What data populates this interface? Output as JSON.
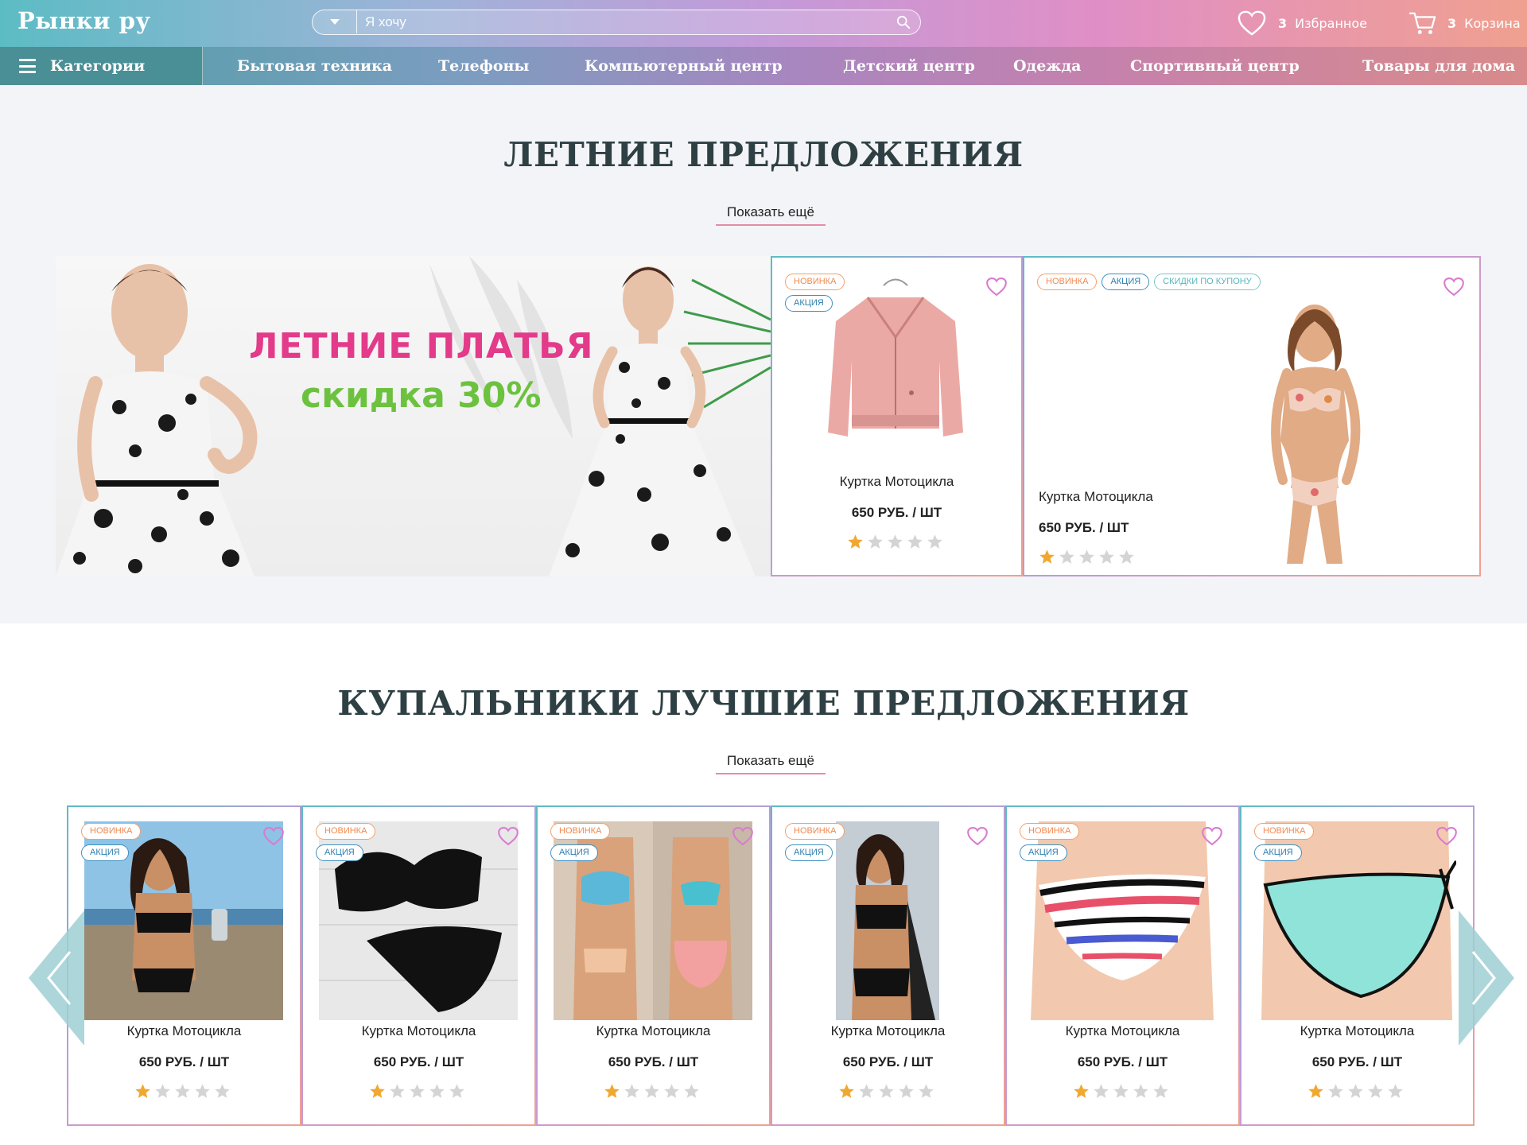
{
  "header": {
    "logo": "Рынки ру",
    "search_placeholder": "Я хочу",
    "favorites_count": "3",
    "favorites_label": "Избранное",
    "cart_count": "3",
    "cart_label": "Корзина"
  },
  "nav": {
    "categories_label": "Категории",
    "items": [
      "Бытовая техника",
      "Телефоны",
      "Компьютерный центр",
      "Детский центр",
      "Одежда",
      "Спортивный центр",
      "Товары для дома"
    ]
  },
  "summer": {
    "title": "ЛЕТНИЕ ПРЕДЛОЖЕНИЯ",
    "show_more": "Показать ещё",
    "banner": {
      "title": "ЛЕТНИЕ ПЛАТЬЯ",
      "subtitle": "скидка 30%"
    },
    "products": [
      {
        "badges": [
          "НОВИНКА",
          "АКЦИЯ"
        ],
        "name": "Куртка Мотоцикла",
        "price": "650 РУБ. / ШТ",
        "rating": 1,
        "max_rating": 5
      },
      {
        "badges": [
          "НОВИНКА",
          "АКЦИЯ",
          "СКИДКИ ПО КУПОНУ"
        ],
        "name": "Куртка Мотоцикла",
        "price": "650 РУБ. / ШТ",
        "rating": 1,
        "max_rating": 5
      }
    ]
  },
  "swimsuits": {
    "title": "КУПАЛЬНИКИ ЛУЧШИЕ ПРЕДЛОЖЕНИЯ",
    "show_more": "Показать ещё",
    "products": [
      {
        "badges": [
          "НОВИНКА",
          "АКЦИЯ"
        ],
        "name": "Куртка Мотоцикла",
        "price": "650 РУБ. / ШТ",
        "rating": 1,
        "max_rating": 5
      },
      {
        "badges": [
          "НОВИНКА",
          "АКЦИЯ"
        ],
        "name": "Куртка Мотоцикла",
        "price": "650 РУБ. / ШТ",
        "rating": 1,
        "max_rating": 5
      },
      {
        "badges": [
          "НОВИНКА",
          "АКЦИЯ"
        ],
        "name": "Куртка Мотоцикла",
        "price": "650 РУБ. / ШТ",
        "rating": 1,
        "max_rating": 5
      },
      {
        "badges": [
          "НОВИНКА",
          "АКЦИЯ"
        ],
        "name": "Куртка Мотоцикла",
        "price": "650 РУБ. / ШТ",
        "rating": 1,
        "max_rating": 5
      },
      {
        "badges": [
          "НОВИНКА",
          "АКЦИЯ"
        ],
        "name": "Куртка Мотоцикла",
        "price": "650 РУБ. / ШТ",
        "rating": 1,
        "max_rating": 5
      },
      {
        "badges": [
          "НОВИНКА",
          "АКЦИЯ"
        ],
        "name": "Куртка Мотоцикла",
        "price": "650 РУБ. / ШТ",
        "rating": 1,
        "max_rating": 5
      }
    ]
  },
  "colors": {
    "heart": "#d97bd0",
    "star_on": "#f0a830",
    "star_off": "#d4d4d4",
    "accent_teal": "#5cbcc4",
    "accent_pink": "#e33a8a"
  }
}
